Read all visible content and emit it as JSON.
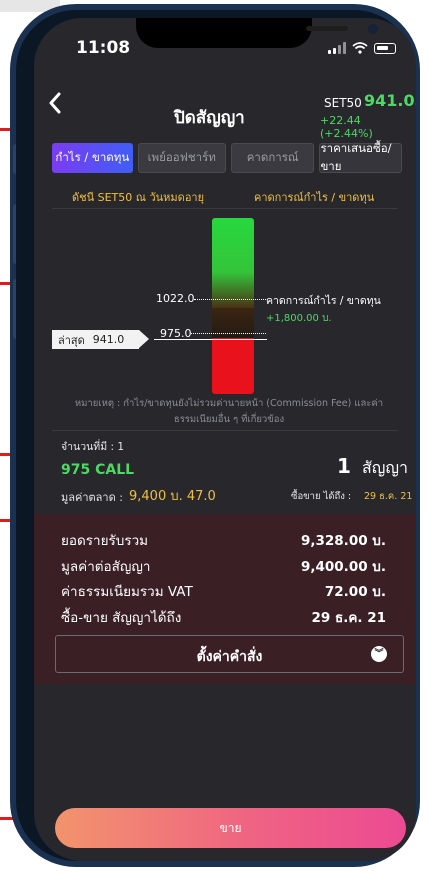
{
  "status": {
    "time": "11:08"
  },
  "header": {
    "back_icon": "chevron-left-icon",
    "title": "ปิดสัญญา",
    "index_name": "SET50",
    "index_value": "941.05",
    "index_change": "+22.44 (+2.44%)"
  },
  "tabs": [
    {
      "label": "กำไร / ขาดทุน",
      "active": true
    },
    {
      "label": "เพย์ออฟชาร์ท",
      "active": false
    },
    {
      "label": "คาดการณ์",
      "active": false
    },
    {
      "label": "ราคาเสนอซื้อ/ขาย",
      "active": false
    }
  ],
  "chart": {
    "left_header": "ดัชนี SET50 ณ วันหมดอายุ",
    "right_header": "คาดการณ์กำไร / ขาดทุน",
    "level_high": "1022.0",
    "level_strike": "975.0",
    "last_label": "ล่าสุด",
    "last_value": "941.0",
    "pl_label": "คาดการณ์กำไร / ขาดทุน",
    "pl_value": "+1,800.00 บ.",
    "note": "หมายเหตุ : กำไร/ขาดทุนยังไม่รวมค่านายหน้า (Commission Fee) และค่าธรรมเนียมอื่น ๆ ที่เกี่ยวข้อง"
  },
  "position": {
    "qty_label": "จำนวนที่มี : 1",
    "series": "975 CALL",
    "contracts_value": "1",
    "contracts_unit": "สัญญา",
    "market_value_label": "มูลค่าตลาด :",
    "market_value": "9,400 บ.  47.0",
    "trade_until_label": "ซื้อขาย ได้ถึง :",
    "trade_until_date": "29 ธ.ค. 21"
  },
  "summary": {
    "rows": [
      {
        "label": "ยอดรายรับรวม",
        "value": "9,328.00 บ."
      },
      {
        "label": "มูลค่าต่อสัญญา",
        "value": "9,400.00 บ."
      },
      {
        "label": "ค่าธรรมเนียมรวม VAT",
        "value": "72.00 บ."
      },
      {
        "label": "ซื้อ-ขาย สัญญาได้ถึง",
        "value": "29 ธ.ค. 21"
      }
    ],
    "order_button": "ตั้งค่าคำสั่ง"
  },
  "sell_button": "ขาย",
  "colors": {
    "background": "#27272c",
    "accent_green": "#4cd964",
    "accent_yellow": "#f0c040",
    "loss_red": "#e8111c",
    "annotation_red": "#e11b1b"
  }
}
